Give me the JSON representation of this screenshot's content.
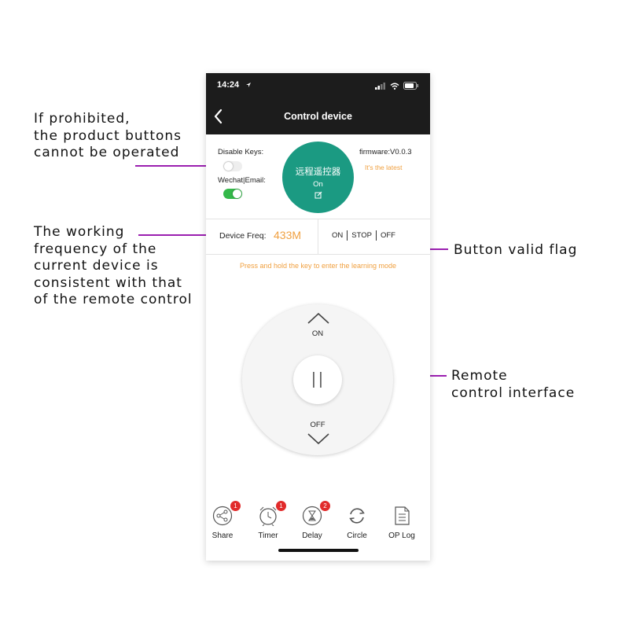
{
  "annotations": {
    "prohibited": "If prohibited,\nthe product buttons\ncannot be operated",
    "frequency": "The working\nfrequency of the\ncurrent device is\nconsistent with that\nof the remote control",
    "valid_flag": "Button valid flag",
    "remote": "Remote\ncontrol interface"
  },
  "status_bar": {
    "time": "14:24"
  },
  "nav": {
    "title": "Control device"
  },
  "device": {
    "disable_keys_label": "Disable Keys:",
    "disable_keys_on": false,
    "wechat_email_label": "Wechat|Email:",
    "wechat_email_on": true,
    "name": "远程遥控器",
    "state": "On",
    "firmware": "firmware:V0.0.3",
    "firmware_status": "It's the latest"
  },
  "freq": {
    "label": "Device Freq:",
    "value": "433M",
    "flags": [
      "ON",
      "STOP",
      "OFF"
    ]
  },
  "hint": "Press and hold the key to enter the learning mode",
  "remote": {
    "up_label": "ON",
    "down_label": "OFF"
  },
  "bottom_bar": [
    {
      "label": "Share",
      "badge": "1",
      "icon": "share-icon"
    },
    {
      "label": "Timer",
      "badge": "1",
      "icon": "alarm-clock-icon"
    },
    {
      "label": "Delay",
      "badge": "2",
      "icon": "hourglass-icon"
    },
    {
      "label": "Circle",
      "badge": "",
      "icon": "refresh-icon"
    },
    {
      "label": "OP Log",
      "badge": "",
      "icon": "document-icon"
    }
  ],
  "colors": {
    "accent": "#1b9a82",
    "orange": "#f0a040",
    "annotation": "#9b1fb0",
    "badge": "#e12b2b"
  }
}
